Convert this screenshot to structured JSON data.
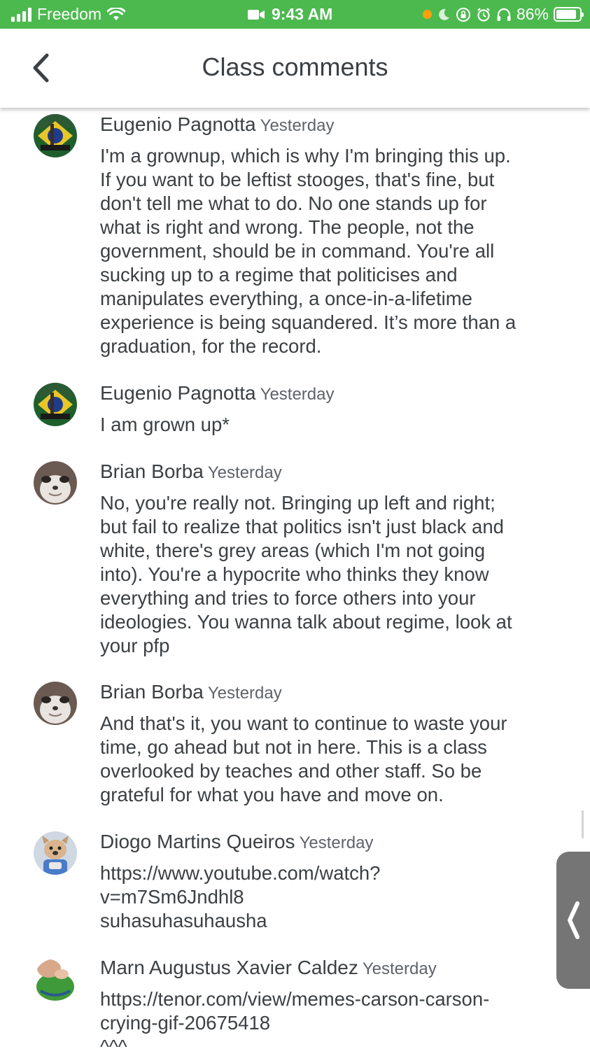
{
  "status_bar": {
    "carrier": "Freedom",
    "time": "9:43 AM",
    "battery_percent": "86%",
    "battery_level": 0.86,
    "background_color": "#4cb94f"
  },
  "header": {
    "title": "Class comments",
    "back_icon": "chevron-left-icon"
  },
  "comments": [
    {
      "author": "Eugenio Pagnotta",
      "time": "Yesterday",
      "text": "I'm a grownup, which is why I'm bringing this up.\nIf you want to be leftist stooges, that's fine, but\ndon't tell me what to do. No one stands up for\nwhat is right and wrong. The people, not the\ngovernment, should be in command. You're all\nsucking up to a regime that politicises and\nmanipulates everything, a once-in-a-lifetime\nexperience is being squandered. It’s more than a\ngraduation, for the record.",
      "avatar": "flag-avatar"
    },
    {
      "author": "Eugenio Pagnotta",
      "time": "Yesterday",
      "text": "I am grown up*",
      "avatar": "flag-avatar"
    },
    {
      "author": "Brian Borba",
      "time": "Yesterday",
      "text": "No, you're really not. Bringing up left and right;\nbut fail to realize that politics isn't just black and\nwhite, there's grey areas (which I'm not going\ninto). You're a hypocrite who thinks they know\neverything and tries to force others into your\nideologies. You wanna talk about regime, look at\nyour pfp",
      "avatar": "animal-face-avatar"
    },
    {
      "author": "Brian Borba",
      "time": "Yesterday",
      "text": "And that's it, you want to continue to waste your\ntime, go ahead but not in here. This is a class\noverlooked by teaches and other staff. So be\ngrateful for what you have and move on.",
      "avatar": "animal-face-avatar"
    },
    {
      "author": "Diogo Martins Queiros",
      "time": "Yesterday",
      "text": "https://www.youtube.com/watch?\nv=m7Sm6Jndhl8\nsuhasuhasuhausha",
      "avatar": "dog-avatar"
    },
    {
      "author": "Marn Augustus Xavier Caldez",
      "time": "Yesterday",
      "text": "https://tenor.com/view/memes-carson-carson-\ncrying-gif-20675418\n^^^",
      "avatar": "frog-avatar"
    }
  ],
  "side_handle_icon": "chevron-left-icon"
}
